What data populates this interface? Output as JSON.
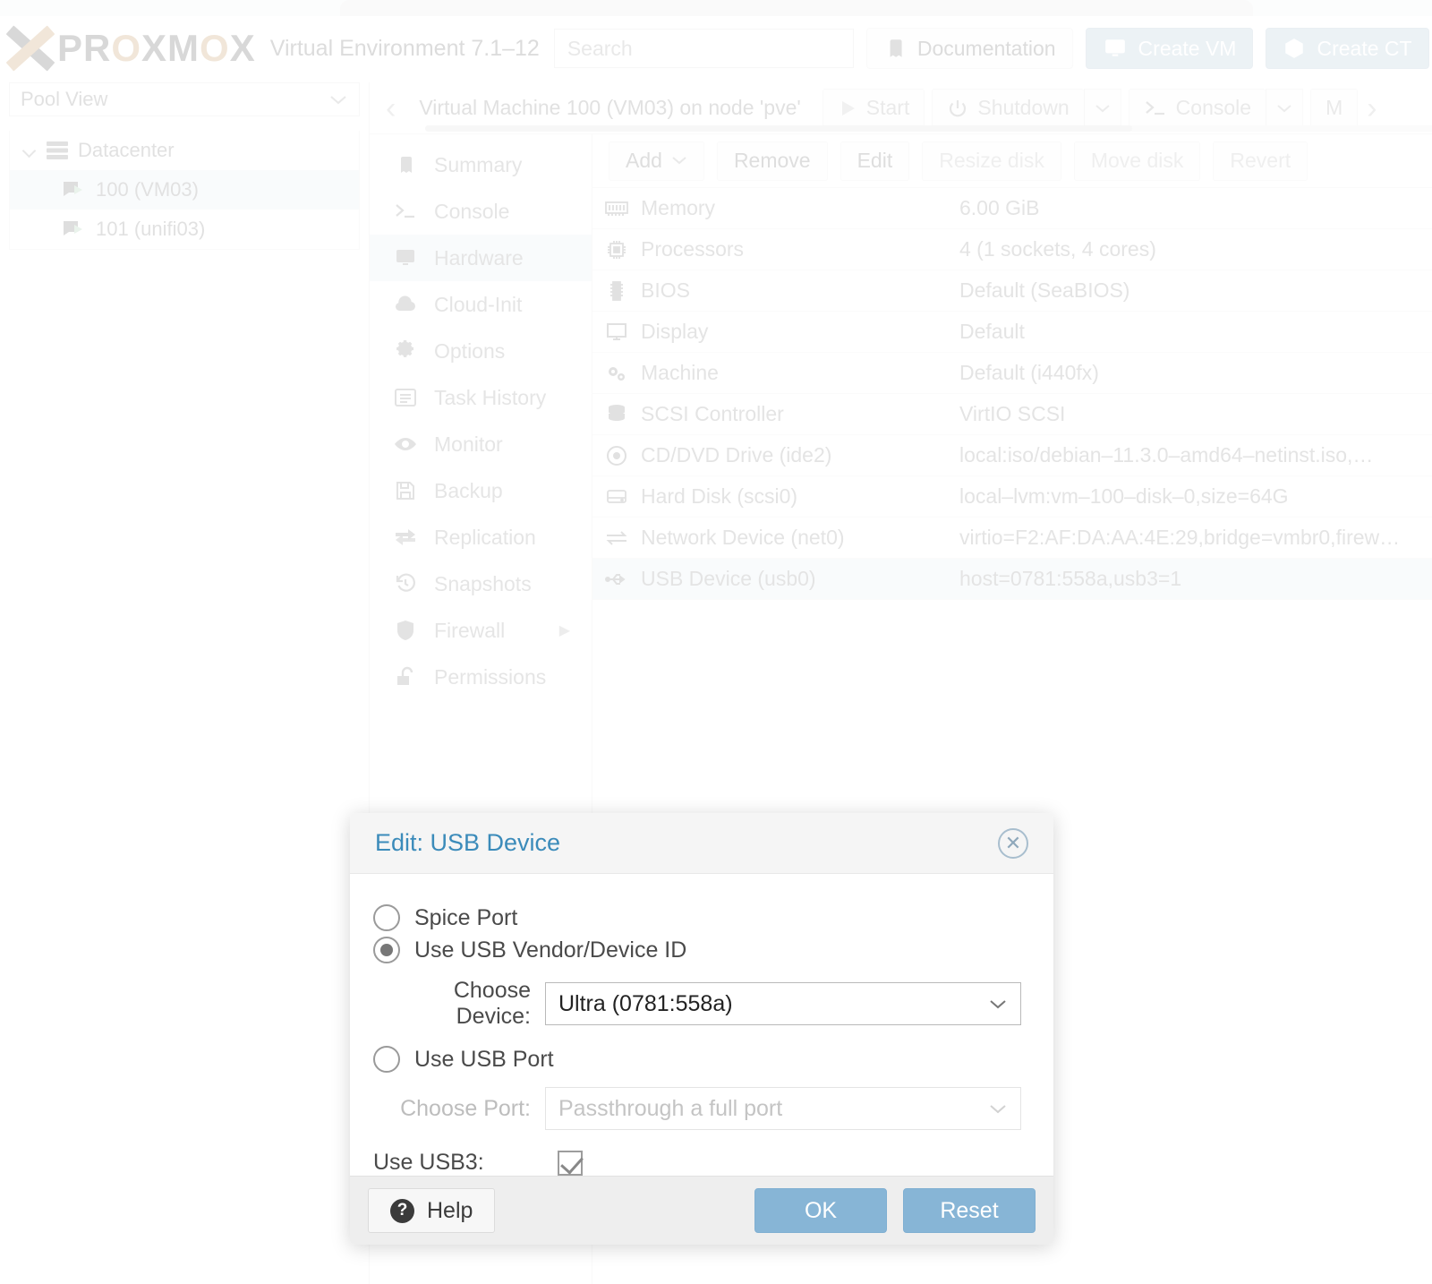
{
  "header": {
    "brand": "PROXMOX",
    "brand_parts": [
      "PR",
      "O",
      "XM",
      "O",
      "X"
    ],
    "product": "Virtual Environment 7.1–12",
    "search_placeholder": "Search",
    "documentation_label": "Documentation",
    "create_vm_label": "Create VM",
    "create_ct_label": "Create CT"
  },
  "sidebar": {
    "view_selector": "Pool View",
    "tree": [
      {
        "label": "Datacenter",
        "icon": "server-icon",
        "level": 0,
        "selected": false
      },
      {
        "label": "100 (VM03)",
        "icon": "vm-running-icon",
        "level": 1,
        "selected": true
      },
      {
        "label": "101 (unifi03)",
        "icon": "vm-running-icon",
        "level": 1,
        "selected": false
      }
    ]
  },
  "vm_toolbar": {
    "title": "Virtual Machine 100 (VM03) on node 'pve'",
    "buttons": [
      {
        "label": "Start",
        "icon": "play-icon"
      },
      {
        "label": "Shutdown",
        "icon": "power-icon",
        "split": true
      },
      {
        "label": "Console",
        "icon": "terminal-icon",
        "split": true
      },
      {
        "label": "M",
        "icon": ""
      }
    ]
  },
  "vm_nav": {
    "items": [
      {
        "label": "Summary",
        "icon": "book-icon",
        "selected": false,
        "submenu": false
      },
      {
        "label": "Console",
        "icon": "terminal-icon",
        "selected": false,
        "submenu": false
      },
      {
        "label": "Hardware",
        "icon": "monitor-icon",
        "selected": true,
        "submenu": false
      },
      {
        "label": "Cloud-Init",
        "icon": "cloud-icon",
        "selected": false,
        "submenu": false
      },
      {
        "label": "Options",
        "icon": "gear-icon",
        "selected": false,
        "submenu": false
      },
      {
        "label": "Task History",
        "icon": "list-icon",
        "selected": false,
        "submenu": false
      },
      {
        "label": "Monitor",
        "icon": "eye-icon",
        "selected": false,
        "submenu": false
      },
      {
        "label": "Backup",
        "icon": "floppy-icon",
        "selected": false,
        "submenu": false
      },
      {
        "label": "Replication",
        "icon": "replication-icon",
        "selected": false,
        "submenu": false
      },
      {
        "label": "Snapshots",
        "icon": "history-icon",
        "selected": false,
        "submenu": false
      },
      {
        "label": "Firewall",
        "icon": "shield-icon",
        "selected": false,
        "submenu": true
      },
      {
        "label": "Permissions",
        "icon": "unlock-icon",
        "selected": false,
        "submenu": false
      }
    ]
  },
  "hardware": {
    "toolbar": [
      {
        "label": "Add",
        "disabled": false,
        "dropdown": true
      },
      {
        "label": "Remove",
        "disabled": false,
        "dropdown": false
      },
      {
        "label": "Edit",
        "disabled": false,
        "dropdown": false
      },
      {
        "label": "Resize disk",
        "disabled": true,
        "dropdown": false
      },
      {
        "label": "Move disk",
        "disabled": true,
        "dropdown": false
      },
      {
        "label": "Revert",
        "disabled": true,
        "dropdown": false
      }
    ],
    "rows": [
      {
        "icon": "memory-icon",
        "name": "Memory",
        "value": "6.00 GiB",
        "selected": false
      },
      {
        "icon": "cpu-icon",
        "name": "Processors",
        "value": "4 (1 sockets, 4 cores)",
        "selected": false
      },
      {
        "icon": "bios-icon",
        "name": "BIOS",
        "value": "Default (SeaBIOS)",
        "selected": false
      },
      {
        "icon": "monitor-icon",
        "name": "Display",
        "value": "Default",
        "selected": false
      },
      {
        "icon": "gears-icon",
        "name": "Machine",
        "value": "Default (i440fx)",
        "selected": false
      },
      {
        "icon": "database-icon",
        "name": "SCSI Controller",
        "value": "VirtIO SCSI",
        "selected": false
      },
      {
        "icon": "disc-icon",
        "name": "CD/DVD Drive (ide2)",
        "value": "local:iso/debian–11.3.0–amd64–netinst.iso,…",
        "selected": false
      },
      {
        "icon": "harddisk-icon",
        "name": "Hard Disk (scsi0)",
        "value": "local–lvm:vm–100–disk–0,size=64G",
        "selected": false
      },
      {
        "icon": "network-icon",
        "name": "Network Device (net0)",
        "value": "virtio=F2:AF:DA:AA:4E:29,bridge=vmbr0,firew…",
        "selected": false
      },
      {
        "icon": "usb-icon",
        "name": "USB Device (usb0)",
        "value": "host=0781:558a,usb3=1",
        "selected": true
      }
    ]
  },
  "dialog": {
    "title": "Edit: USB Device",
    "close_icon": "close-circle-icon",
    "options": [
      {
        "label": "Spice Port",
        "checked": false
      },
      {
        "label": "Use USB Vendor/Device ID",
        "checked": true
      },
      {
        "label": "Use USB Port",
        "checked": false
      }
    ],
    "device_field": {
      "label": "Choose Device:",
      "value": "Ultra (0781:558a)",
      "disabled": false
    },
    "port_field": {
      "label": "Choose Port:",
      "value": "Passthrough a full port",
      "disabled": true
    },
    "usb3": {
      "label": "Use USB3:",
      "checked": true
    },
    "footer": {
      "help_label": "Help",
      "ok_label": "OK",
      "reset_label": "Reset"
    }
  },
  "colors": {
    "accent_blue": "#3b8bba",
    "button_blue": "#87b5d6",
    "brand_orange": "#e8a857",
    "brand_grey": "#7d7d7d",
    "selection_blue": "#e8f1f9"
  }
}
